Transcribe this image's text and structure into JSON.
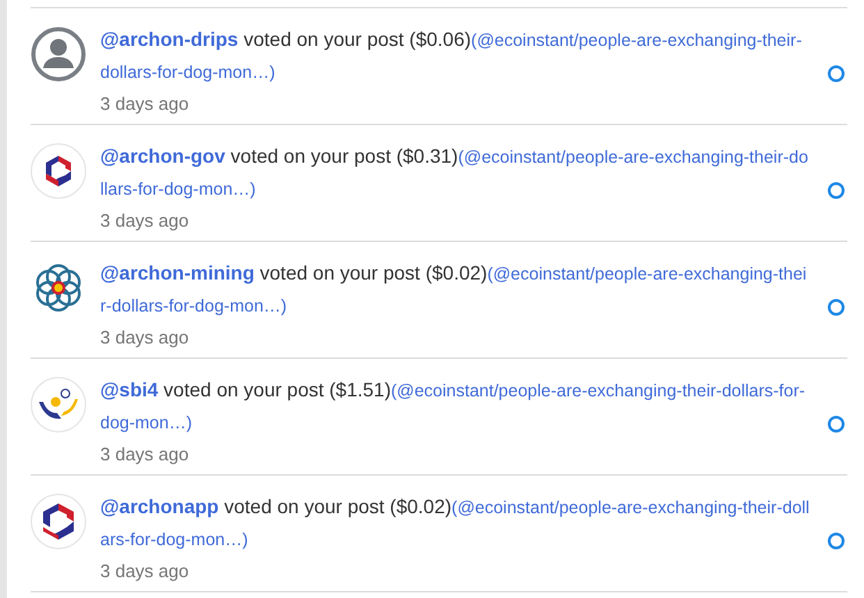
{
  "notifications": [
    {
      "user": "@archon-drips",
      "action": "voted on your post ($0.06)",
      "link": "(@ecoinstant/people-are-exchanging-their-dollars-for-dog-mon…)",
      "time": "3 days ago",
      "selected": false
    },
    {
      "user": "@archon-gov",
      "action": "voted on your post ($0.31)",
      "link": "(@ecoinstant/people-are-exchanging-their-dollars-for-dog-mon…)",
      "time": "3 days ago",
      "selected": false
    },
    {
      "user": "@archon-mining",
      "action": "voted on your post ($0.02)",
      "link": "(@ecoinstant/people-are-exchanging-their-dollars-for-dog-mon…)",
      "time": "3 days ago",
      "selected": false
    },
    {
      "user": "@sbi4",
      "action": "voted on your post ($1.51)",
      "link": "(@ecoinstant/people-are-exchanging-their-dollars-for-dog-mon…)",
      "time": "3 days ago",
      "selected": false
    },
    {
      "user": "@archonapp",
      "action": "voted on your post ($0.02)",
      "link": "(@ecoinstant/people-are-exchanging-their-dollars-for-dog-mon…)",
      "time": "3 days ago",
      "selected": false
    }
  ]
}
